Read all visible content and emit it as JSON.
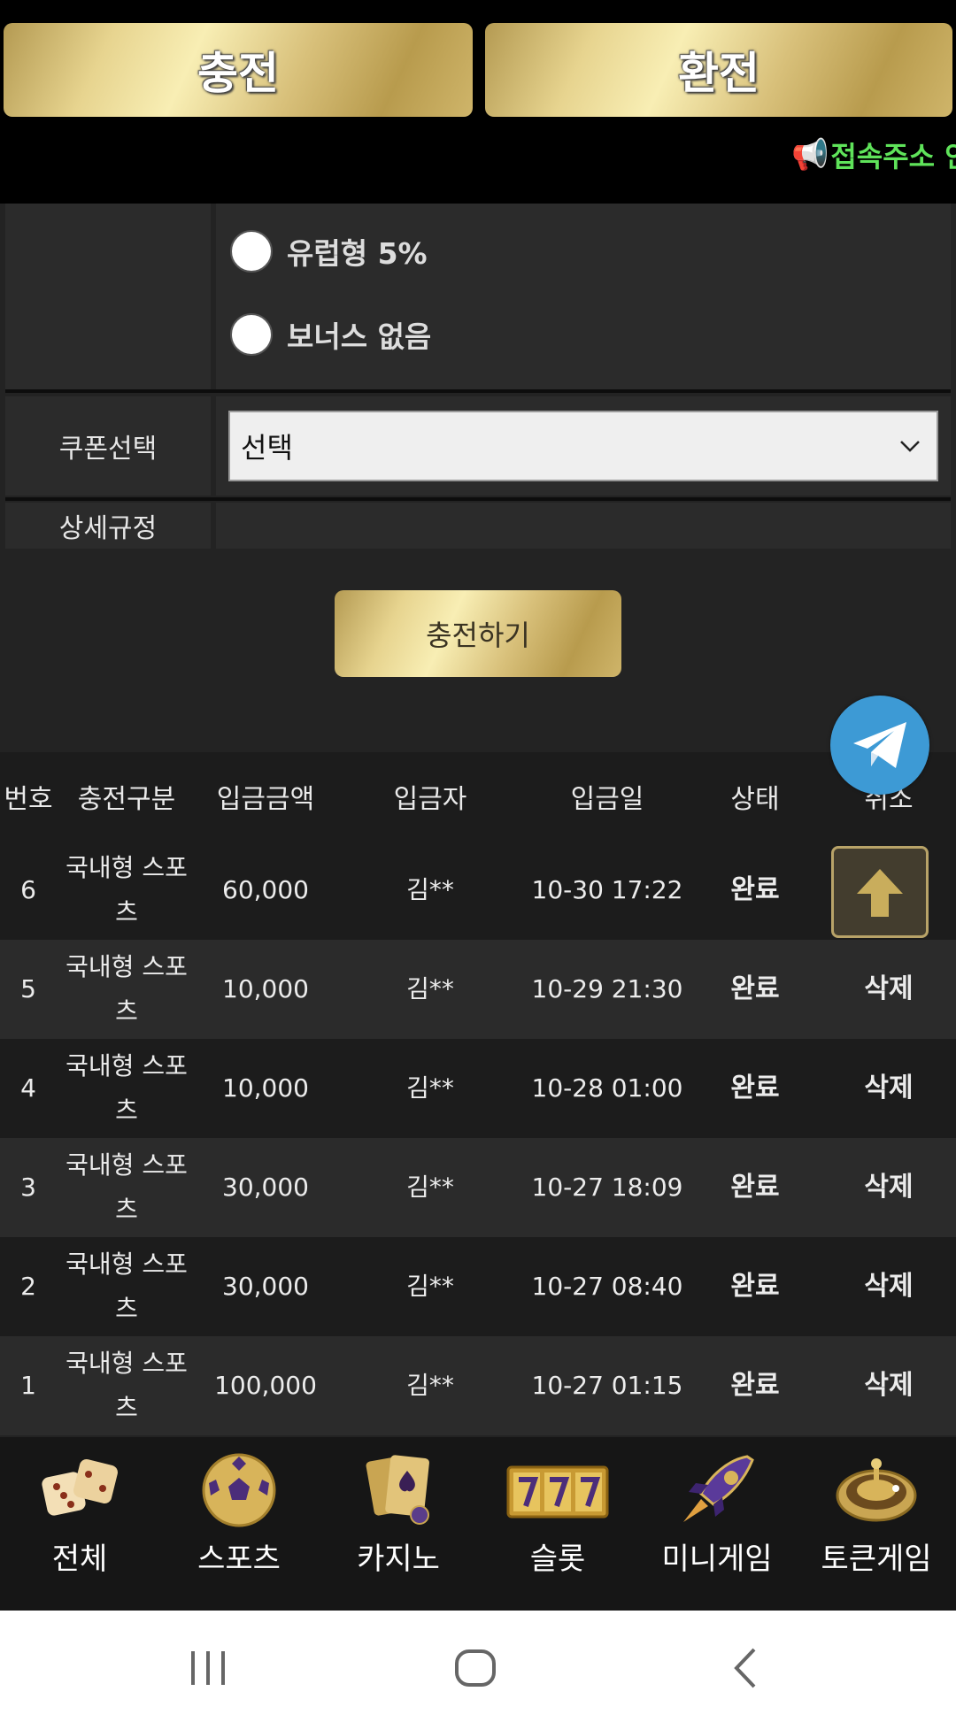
{
  "header": {
    "charge_label": "충전",
    "exchange_label": "환전",
    "notice_text": "접속주소 안"
  },
  "form": {
    "bonus_options": [
      {
        "label": "유럽형 5%",
        "selected": false
      },
      {
        "label": "보너스 없음",
        "selected": false
      }
    ],
    "coupon_label": "쿠폰선택",
    "coupon_value": "선택",
    "rules_label": "상세규정",
    "submit_label": "충전하기"
  },
  "table": {
    "headers": [
      "번호",
      "충전구분",
      "입금금액",
      "입금자",
      "입금일",
      "상태",
      "취소"
    ],
    "rows": [
      {
        "no": "6",
        "type": "국내형 스포츠",
        "amount": "60,000",
        "depositor": "김**",
        "date": "10-30 17:22",
        "status": "완료",
        "cancel": ""
      },
      {
        "no": "5",
        "type": "국내형 스포츠",
        "amount": "10,000",
        "depositor": "김**",
        "date": "10-29 21:30",
        "status": "완료",
        "cancel": "삭제"
      },
      {
        "no": "4",
        "type": "국내형 스포츠",
        "amount": "10,000",
        "depositor": "김**",
        "date": "10-28 01:00",
        "status": "완료",
        "cancel": "삭제"
      },
      {
        "no": "3",
        "type": "국내형 스포츠",
        "amount": "30,000",
        "depositor": "김**",
        "date": "10-27 18:09",
        "status": "완료",
        "cancel": "삭제"
      },
      {
        "no": "2",
        "type": "국내형 스포츠",
        "amount": "30,000",
        "depositor": "김**",
        "date": "10-27 08:40",
        "status": "완료",
        "cancel": "삭제"
      },
      {
        "no": "1",
        "type": "국내형 스포츠",
        "amount": "100,000",
        "depositor": "김**",
        "date": "10-27 01:15",
        "status": "완료",
        "cancel": "삭제"
      }
    ]
  },
  "bottom_nav": [
    {
      "label": "전체",
      "icon": "dice-icon"
    },
    {
      "label": "스포츠",
      "icon": "soccer-ball-icon"
    },
    {
      "label": "카지노",
      "icon": "playing-cards-icon"
    },
    {
      "label": "슬롯",
      "icon": "slot-777-icon"
    },
    {
      "label": "미니게임",
      "icon": "rocket-icon"
    },
    {
      "label": "토큰게임",
      "icon": "roulette-icon"
    }
  ],
  "colors": {
    "gold": "#e7d48f",
    "notice": "#5fe35a",
    "telegram": "#3d9ad5",
    "background": "#232323"
  }
}
